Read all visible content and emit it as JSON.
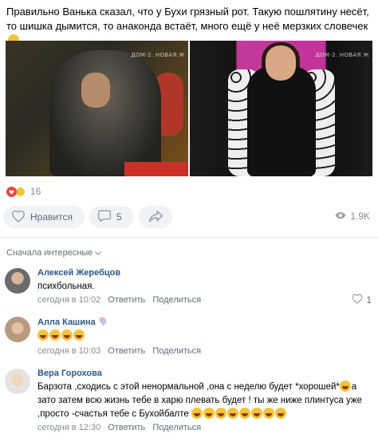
{
  "post": {
    "text": "Правильно Ванька сказал, что у Бухи грязный рот. Такую пошлятину несёт, то шишка дымится, то анаконда встаёт, много ещё у неё мерзких словечек",
    "text_emoji": "nauseated-face",
    "photos": [
      {
        "watermark": "ДОМ-2. НОВАЯ Ж",
        "alt_icon": "photo-man-in-parka"
      },
      {
        "watermark": "ДОМ-2. НОВАЯ Ж",
        "alt_icon": "photo-woman-in-fur-coat"
      }
    ],
    "reactions": {
      "icons": [
        "heart-reaction",
        "laughing-reaction"
      ],
      "count": "16"
    },
    "actions": {
      "like_label": "Нравится",
      "comment_count": "5",
      "views": "1.9K"
    }
  },
  "comments_sort": "Сначала интересные",
  "comments": [
    {
      "author": "Алексей Жеребцов",
      "text": "психбольная.",
      "time": "сегодня в 10:02",
      "reply": "Ответить",
      "share": "Поделиться",
      "likes": "1"
    },
    {
      "author": "Алла Кашина",
      "text_emoji_count": 4,
      "time": "сегодня в 10:03",
      "reply": "Ответить",
      "share": "Поделиться"
    },
    {
      "author": "Вера Горохова",
      "text": "Барзота ,сходись с этой ненормальной ,она с неделю будет *хорошей*",
      "text2": "а зато затем всю жизнь тебе в харю плевать будет ! ты же ниже плинтуса уже ,просто -счастья тебе с Бухойбалте",
      "time": "сегодня в 12:30",
      "reply": "Ответить",
      "share": "Поделиться"
    }
  ],
  "colors": {
    "link": "#2a5885",
    "muted": "#818c99",
    "pill_bg": "#f0f2f5",
    "heart": "#e64646"
  }
}
